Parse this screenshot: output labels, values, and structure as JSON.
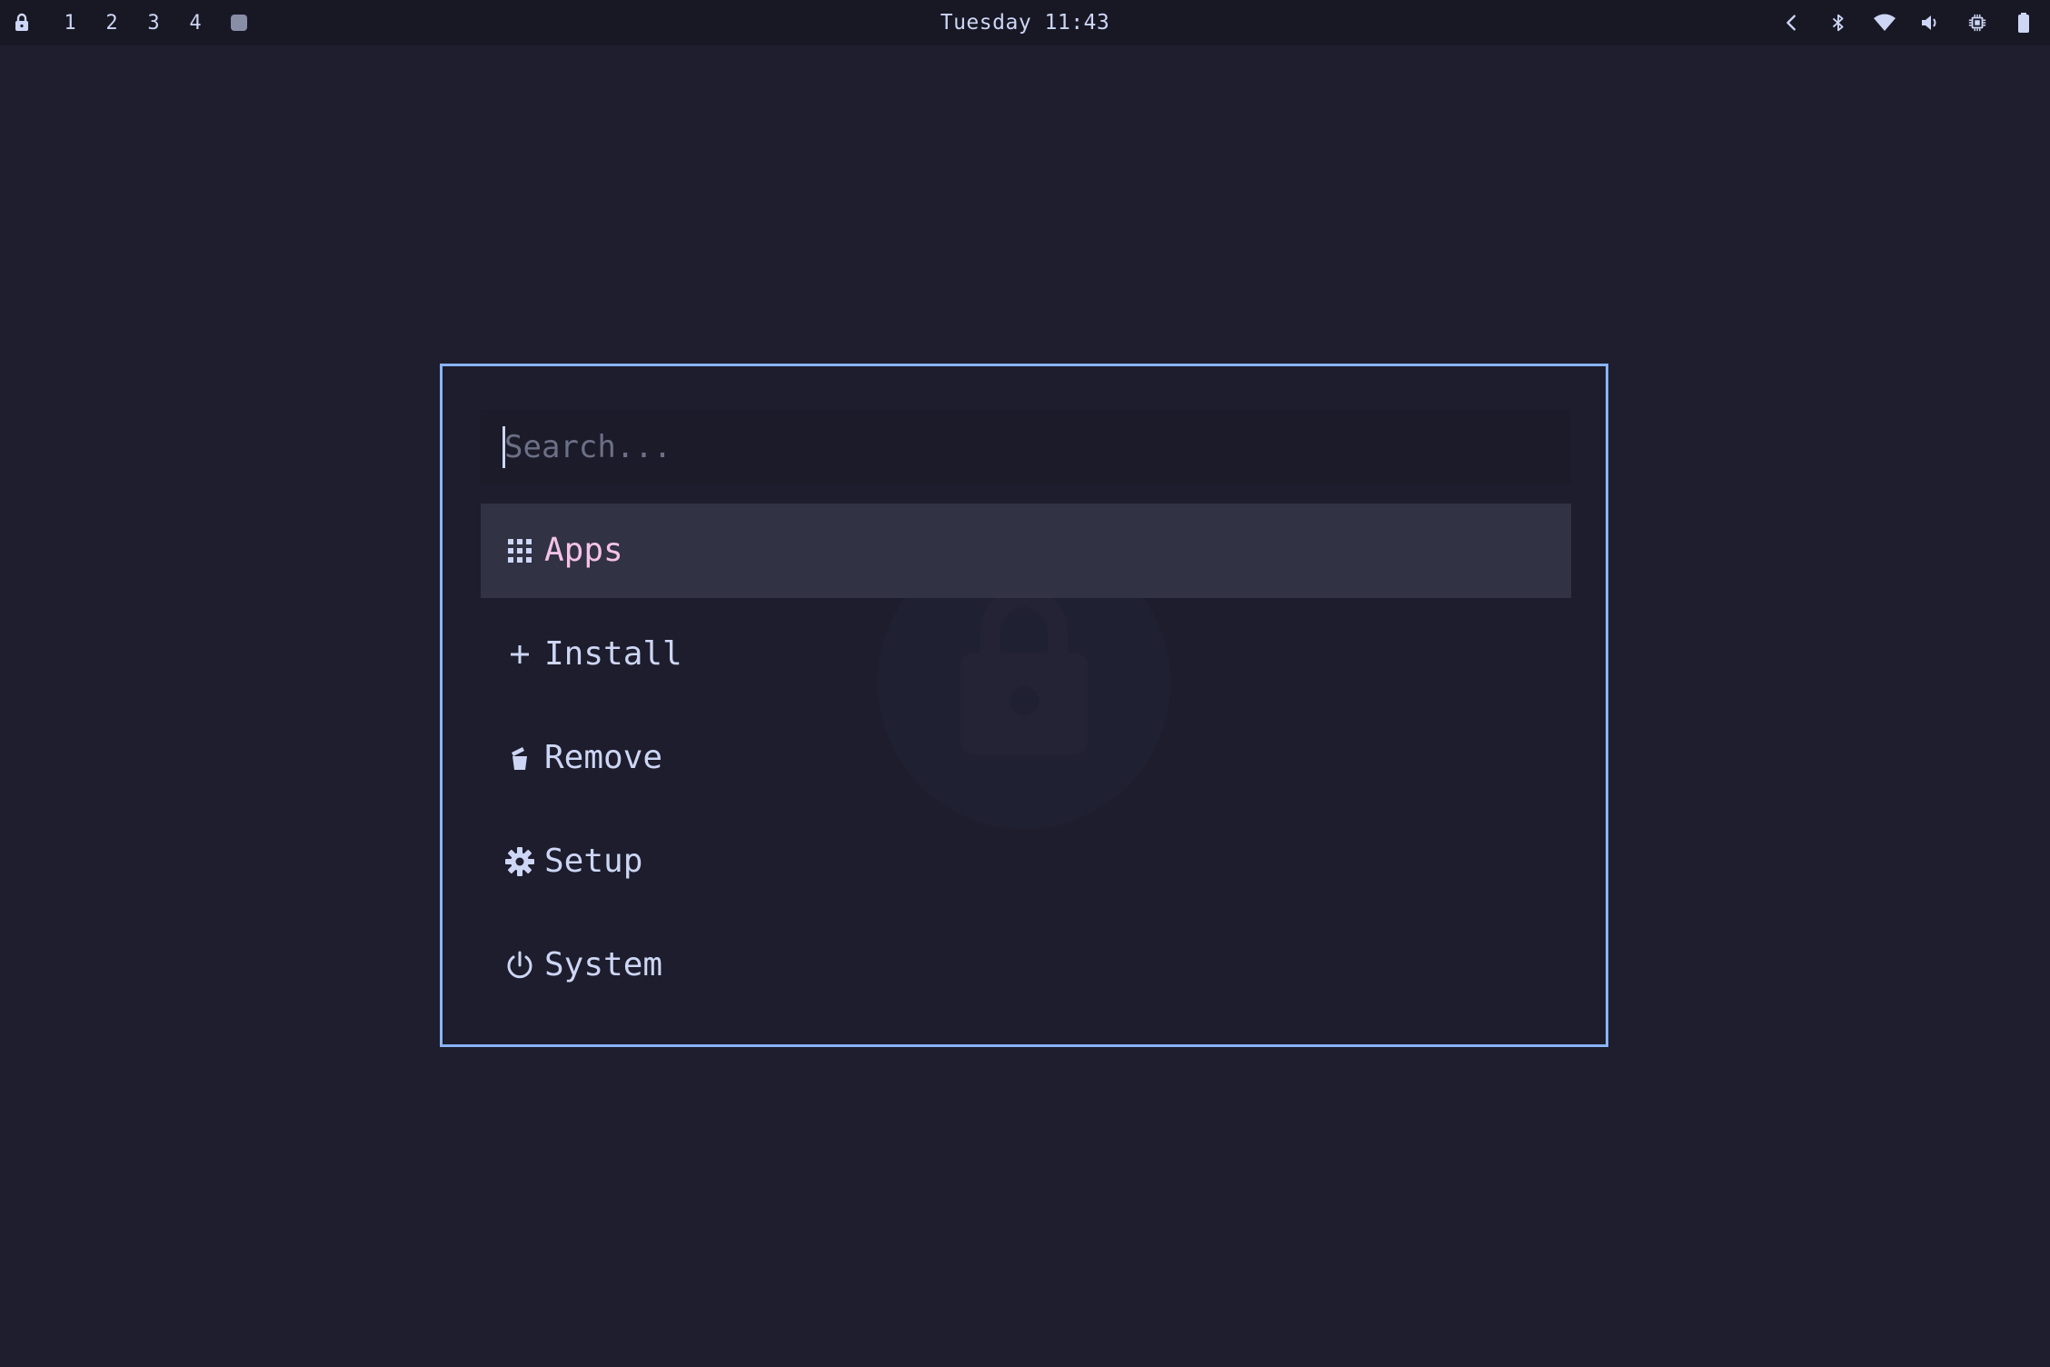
{
  "topbar": {
    "workspaces": [
      "1",
      "2",
      "3",
      "4"
    ],
    "clock": "Tuesday 11:43",
    "icons": [
      "lock-icon",
      "chevron-left-icon",
      "bluetooth-icon",
      "wifi-icon",
      "volume-icon",
      "cpu-icon",
      "battery-icon"
    ]
  },
  "launcher": {
    "search": {
      "placeholder": "Search...",
      "value": ""
    },
    "items": [
      {
        "label": "Apps",
        "icon": "grid-icon",
        "selected": true
      },
      {
        "label": "Install",
        "icon": "plus-icon",
        "selected": false
      },
      {
        "label": "Remove",
        "icon": "trash-icon",
        "selected": false
      },
      {
        "label": "Setup",
        "icon": "gear-icon",
        "selected": false
      },
      {
        "label": "System",
        "icon": "power-icon",
        "selected": false
      }
    ]
  },
  "colors": {
    "background": "#1e1e2e",
    "bar": "#181825",
    "border": "#89b4fa",
    "selected_bg": "#313244",
    "selected_text": "#f5c2e7",
    "text": "#cdd6f4",
    "placeholder": "#6c7086"
  }
}
